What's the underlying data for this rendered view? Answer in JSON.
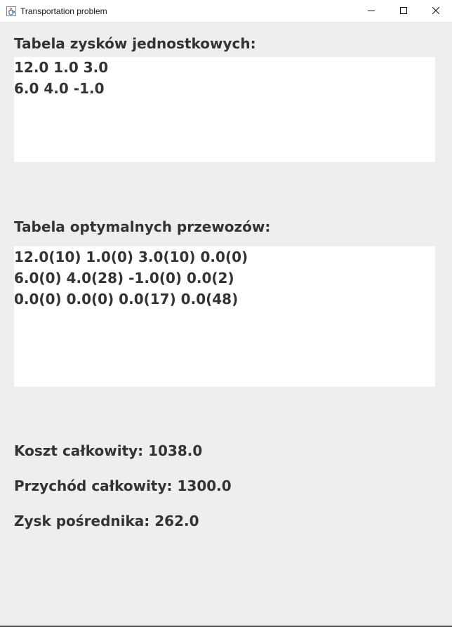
{
  "window": {
    "title": "Transportation problem"
  },
  "unit_profits": {
    "label": "Tabela zysków jednostkowych:",
    "rows": [
      "12.0 1.0 3.0",
      "6.0 4.0 -1.0"
    ]
  },
  "optimal_transport": {
    "label": "Tabela optymalnych przewozów:",
    "rows": [
      "12.0(10) 1.0(0) 3.0(10) 0.0(0)",
      "6.0(0) 4.0(28) -1.0(0) 0.0(2)",
      "0.0(0) 0.0(0) 0.0(17) 0.0(48)"
    ]
  },
  "summary": {
    "total_cost": "Koszt całkowity: 1038.0",
    "total_revenue": "Przychód całkowity: 1300.0",
    "broker_profit": "Zysk pośrednika: 262.0"
  },
  "icons": {
    "app": "java-cup-icon",
    "minimize": "minimize-icon",
    "maximize": "maximize-icon",
    "close": "close-icon"
  }
}
